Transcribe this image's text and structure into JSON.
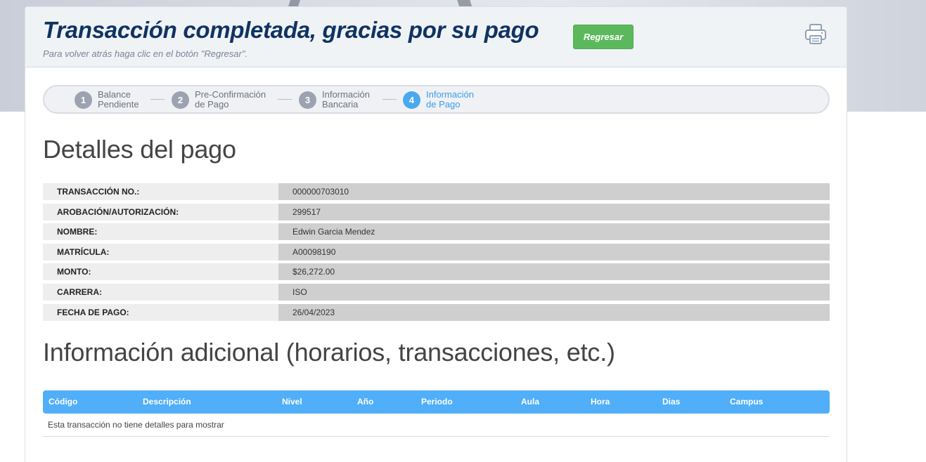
{
  "header": {
    "title": "Transacción completada, gracias por su pago",
    "back_label": "Regresar",
    "subtitle": "Para volver atrás haga clic en el botón \"Regresar\"."
  },
  "stepper": {
    "steps": [
      {
        "number": "1",
        "line1": "Balance",
        "line2": "Pendiente",
        "active": false
      },
      {
        "number": "2",
        "line1": "Pre-Confirmación",
        "line2": "de Pago",
        "active": false
      },
      {
        "number": "3",
        "line1": "Información",
        "line2": "Bancaria",
        "active": false
      },
      {
        "number": "4",
        "line1": "Información",
        "line2": "de Pago",
        "active": true
      }
    ]
  },
  "details": {
    "title": "Detalles del pago",
    "rows": [
      {
        "label": "TRANSACCIÓN NO.:",
        "value": "000000703010"
      },
      {
        "label": "AROBACIÓN/AUTORIZACIÓN:",
        "value": "299517"
      },
      {
        "label": "NOMBRE:",
        "value": "Edwin Garcia Mendez"
      },
      {
        "label": "MATRÍCULA:",
        "value": "A00098190"
      },
      {
        "label": "MONTO:",
        "value": "$26,272.00"
      },
      {
        "label": "CARRERA:",
        "value": "ISO"
      },
      {
        "label": "FECHA DE PAGO:",
        "value": "26/04/2023"
      }
    ]
  },
  "additional": {
    "title": "Información adicional (horarios, transacciones, etc.)",
    "columns": [
      "Código",
      "Descripción",
      "Nivel",
      "Año",
      "Periodo",
      "Aula",
      "Hora",
      "Dias",
      "Campus"
    ],
    "empty_message": "Esta transacción no tiene detalles para mostrar"
  },
  "colors": {
    "title": "#0f3463",
    "button": "#5cb85c",
    "active_step": "#4aa9ee",
    "table_header": "#51aef8"
  },
  "icons": {
    "print": "printer-icon"
  }
}
